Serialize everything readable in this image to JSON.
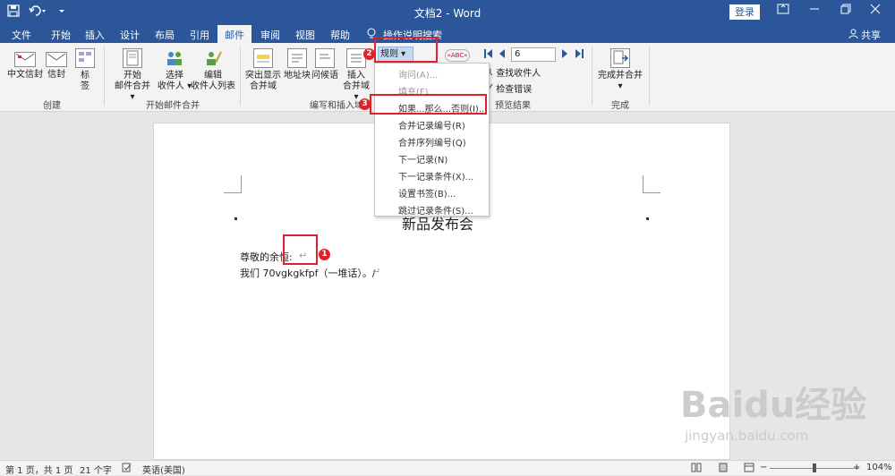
{
  "titlebar": {
    "doc_title": "文档2 - Word",
    "login": "登录",
    "icons": [
      "save-icon",
      "undo-icon",
      "customize-icon",
      "ribbon-display-icon",
      "minimize-icon",
      "restore-icon",
      "close-icon"
    ]
  },
  "tabs": [
    "文件",
    "开始",
    "插入",
    "设计",
    "布局",
    "引用",
    "邮件",
    "审阅",
    "视图",
    "帮助",
    "操作说明搜索"
  ],
  "share": "共享",
  "ribbon": {
    "create": {
      "label": "创建",
      "btn1": "中文信封",
      "btn2": "信封",
      "btn3_line1": "标",
      "btn3_line2": "签"
    },
    "start_merge": {
      "label": "开始邮件合并",
      "btn1_line1": "开始",
      "btn1_line2": "邮件合并 ▾",
      "btn2_line1": "选择",
      "btn2_line2": "收件人 ▾",
      "btn3_line1": "编辑",
      "btn3_line2": "收件人列表"
    },
    "write_insert": {
      "label": "编写和插入域",
      "btn1_line1": "突出显示",
      "btn1_line2": "合并域",
      "btn2": "地址块",
      "btn3": "问候语",
      "btn4_line1": "插入",
      "btn4_line2": "合并域 ▾",
      "rules": "规则 ▾",
      "abc": "«ABC»"
    },
    "preview": {
      "label": "预览结果",
      "record_value": "6",
      "find_recipient": "查找收件人",
      "check_errors": "检查错误"
    },
    "finish": {
      "label": "完成",
      "btn1_line1": "完成并合并",
      "btn1_line2": "▾"
    }
  },
  "dropdown": {
    "items": [
      "询问(A)...",
      "填充(F)...",
      "如果...那么...否则(I)...",
      "合并记录编号(R)",
      "合并序列编号(Q)",
      "下一记录(N)",
      "下一记录条件(X)...",
      "设置书签(B)...",
      "跳过记录条件(S)..."
    ]
  },
  "document": {
    "heading": "新品发布会",
    "line1": "尊敬的余恒:",
    "line2": "我们 70vgkgkfpf（一堆话）。/"
  },
  "badges": [
    "1",
    "2",
    "3"
  ],
  "status": {
    "page": "第 1 页，共 1 页",
    "words": "21 个字",
    "lang": "英语(美国)",
    "zoom": "104%",
    "minus": "−",
    "plus": "+"
  },
  "watermark": {
    "text": "Baidu经验",
    "url": "jingyan.baidu.com"
  },
  "colors": {
    "accent": "#2b579a",
    "highlight": "#e0202a"
  }
}
